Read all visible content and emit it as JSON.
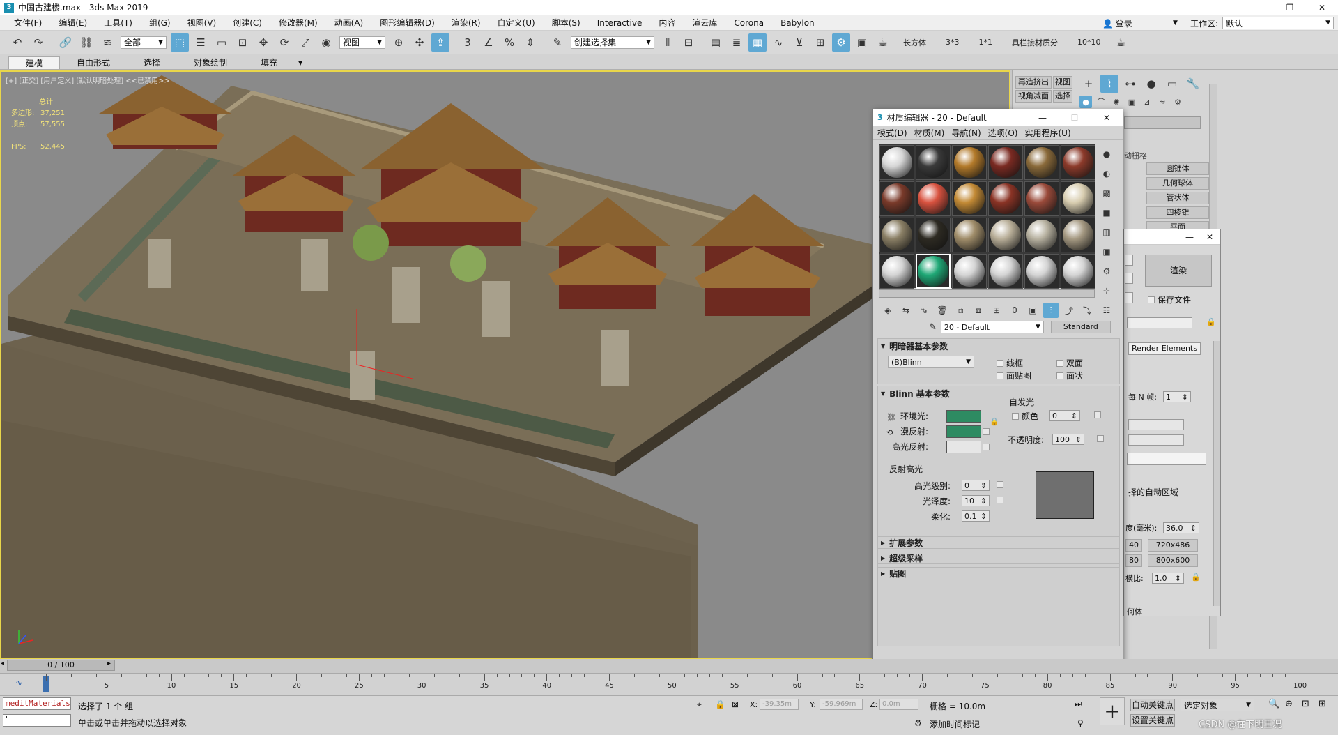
{
  "app": {
    "title": "中国古建楼.max - 3ds Max 2019",
    "icon": "3"
  },
  "menu": {
    "items": [
      "文件(F)",
      "编辑(E)",
      "工具(T)",
      "组(G)",
      "视图(V)",
      "创建(C)",
      "修改器(M)",
      "动画(A)",
      "图形编辑器(D)",
      "渲染(R)",
      "自定义(U)",
      "脚本(S)",
      "Interactive",
      "内容",
      "渲云库",
      "Corona",
      "Babylon"
    ],
    "login_label": "登录",
    "workspace_label": "工作区:",
    "workspace_value": "默认"
  },
  "toolbar": {
    "selection_filter": "全部",
    "ref_coord": "视图",
    "named_selection": "创建选择集",
    "extras": [
      "长方体",
      "3*3",
      "1*1",
      "具栏接材质分",
      "10*10"
    ]
  },
  "ribbon": {
    "tabs": [
      "建模",
      "自由形式",
      "选择",
      "对象绘制",
      "填充"
    ]
  },
  "viewport": {
    "label": "[+] [正交] [用户定义] [默认明暗处理] <<已禁用>>",
    "stats_header": "总计",
    "stats": [
      {
        "k": "多边形:",
        "v": "37,251"
      },
      {
        "k": "顶点:",
        "v": "57,555"
      },
      {
        "k": "FPS:",
        "v": "52.445"
      }
    ]
  },
  "cmdpanel": {
    "quick_buttons": [
      "再造挤出",
      "视图",
      "视角减面",
      "选择"
    ],
    "object_types": [
      "圆锥体",
      "几何球体",
      "管状体",
      "四棱锥",
      "平面"
    ],
    "partial_label": "动栅格"
  },
  "render_dialog": {
    "render_btn": "渲染",
    "save_file": "保存文件",
    "tab": "Render Elements",
    "frame_label": "每 N 帧:",
    "frame_value": "1",
    "auto_region": "择的自动区域",
    "aperture_label": "度(毫米):",
    "aperture_value": "36.0",
    "res_a": "720x486",
    "res_b": "800x600",
    "num_a": "40",
    "num_b": "80",
    "ratio_label": "横比:",
    "ratio_value": "1.0",
    "geometry": "何体"
  },
  "mated": {
    "title": "材质编辑器 - 20 - Default",
    "menu": [
      "模式(D)",
      "材质(M)",
      "导航(N)",
      "选项(O)",
      "实用程序(U)"
    ],
    "material_name": "20 - Default",
    "material_type": "Standard",
    "slots": [
      "#d6d6d6",
      "#3a3a3a",
      "#b37a2a",
      "#7a2a22",
      "#8a6a3a",
      "#8c3a2a",
      "#7a3a2a",
      "#d8523f",
      "#c38a35",
      "#8a3325",
      "#9a4a3a",
      "#d8cdb0",
      "#8a7f65",
      "#2d2a22",
      "#a08d6a",
      "#b8ae98",
      "#b7b1a0",
      "#a59982",
      "#d4d4d4",
      "#1fa876",
      "#d4d4d4",
      "#d4d4d4",
      "#d4d4d4",
      "#d4d4d4"
    ],
    "shader_rollout": "明暗器基本参数",
    "shader_value": "(B)Blinn",
    "shader_opts": [
      "线框",
      "双面",
      "面贴图",
      "面状"
    ],
    "blinn_rollout": "Blinn 基本参数",
    "self_illum": "自发光",
    "color_label": "颜色",
    "color_value": "0",
    "ambient": "环境光:",
    "diffuse": "漫反射:",
    "specular": "高光反射:",
    "ambient_color": "#2e8b62",
    "diffuse_color": "#2e8b62",
    "specular_color": "#e6e6e6",
    "opacity_label": "不透明度:",
    "opacity_value": "100",
    "spec_group": "反射高光",
    "spec_level_label": "高光级别:",
    "spec_level": "0",
    "gloss_label": "光泽度:",
    "gloss": "10",
    "soften_label": "柔化:",
    "soften": "0.1",
    "rollouts": [
      "扩展参数",
      "超级采样",
      "贴图"
    ]
  },
  "timeline": {
    "frame": "0 / 100",
    "ticks": [
      0,
      5,
      10,
      15,
      20,
      25,
      30,
      35,
      40,
      45,
      50,
      55,
      60,
      65,
      70,
      75,
      80,
      85,
      90,
      95,
      100
    ]
  },
  "status": {
    "maxscript": "meditMaterials",
    "maxscript2": "\"",
    "selected": "选择了 1 个 组",
    "hint": "单击或单击并拖动以选择对象",
    "x_label": "X:",
    "x_value": "-39.35m",
    "y_label": "Y:",
    "y_value": "-59.969m",
    "z_label": "Z:",
    "z_value": "0.0m",
    "grid": "栅格 = 10.0m",
    "auto_key": "自动关键点",
    "set_key": "设置关键点",
    "selected_obj": "选定对象",
    "add_time_tag": "添加时间标记",
    "watermark": "CSDN @在下明王况"
  }
}
